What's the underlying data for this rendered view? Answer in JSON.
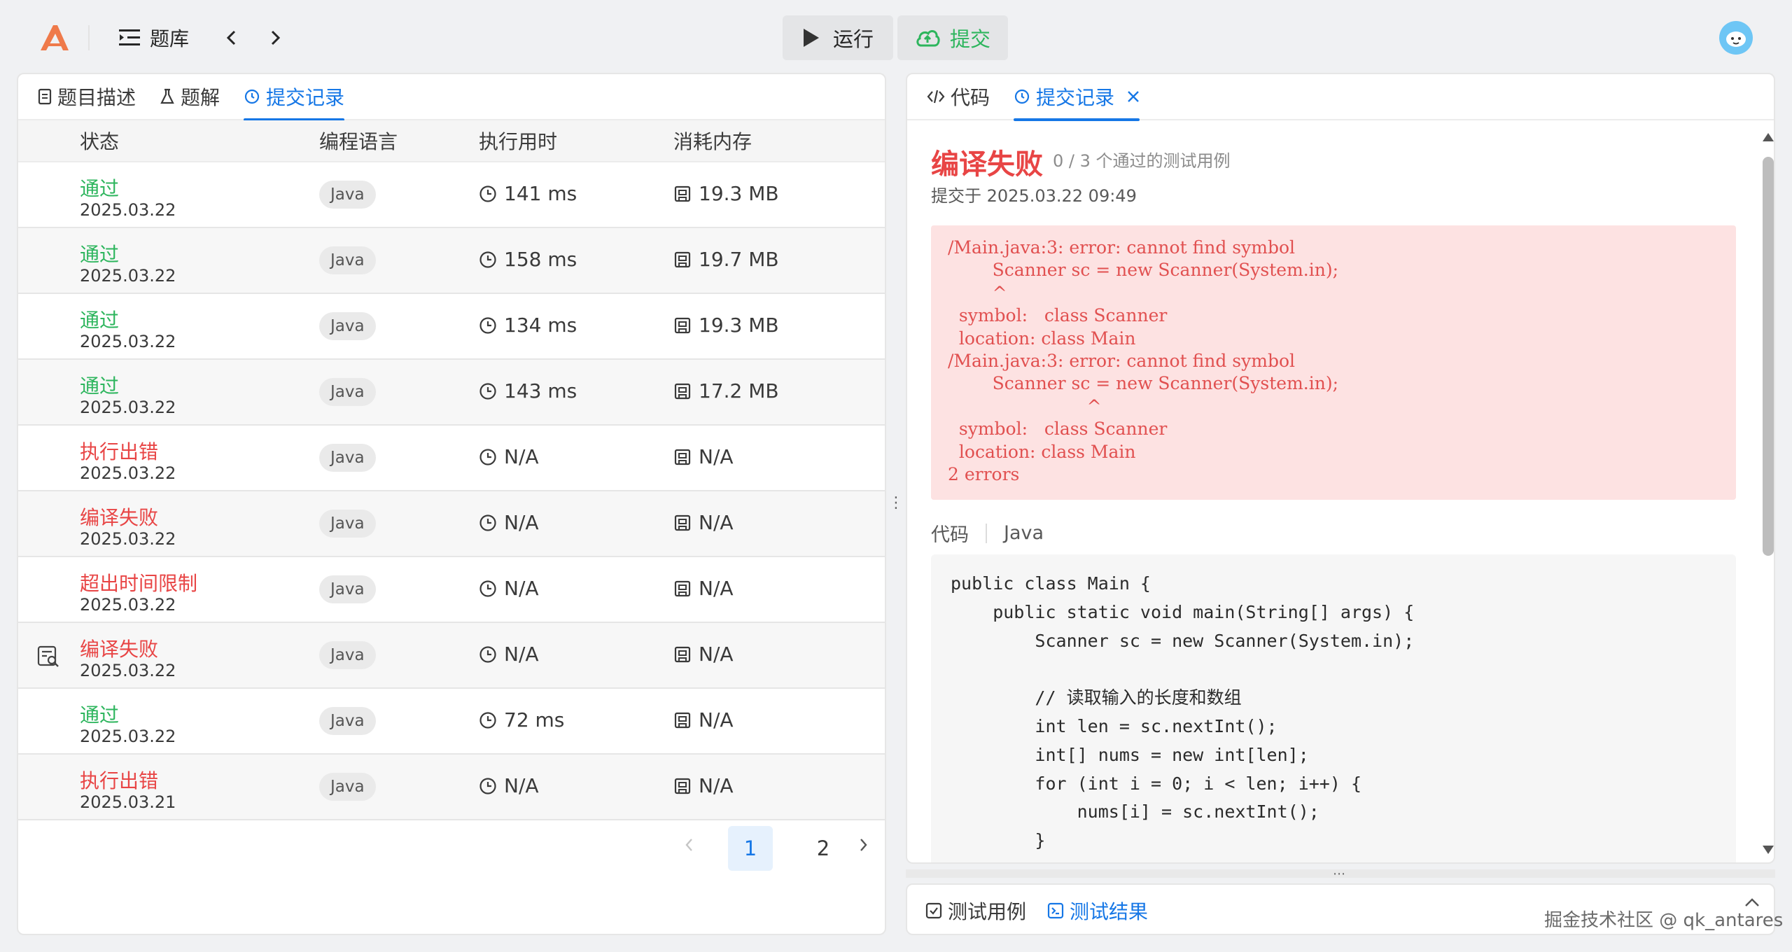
{
  "topbar": {
    "problem_bank_label": "题库",
    "run_label": "运行",
    "submit_label": "提交",
    "colors": {
      "submit": "#2db55d",
      "accent": "#1677e6"
    }
  },
  "left": {
    "tabs": [
      {
        "label": "题目描述",
        "icon": "document-icon"
      },
      {
        "label": "题解",
        "icon": "flask-icon"
      },
      {
        "label": "提交记录",
        "icon": "history-icon"
      }
    ],
    "headers": {
      "status": "状态",
      "lang": "编程语言",
      "time": "执行用时",
      "mem": "消耗内存"
    },
    "rows": [
      {
        "status": "通过",
        "date": "2025.03.22",
        "lang": "Java",
        "time": "141 ms",
        "mem": "19.3 MB"
      },
      {
        "status": "通过",
        "date": "2025.03.22",
        "lang": "Java",
        "time": "158 ms",
        "mem": "19.7 MB"
      },
      {
        "status": "通过",
        "date": "2025.03.22",
        "lang": "Java",
        "time": "134 ms",
        "mem": "19.3 MB"
      },
      {
        "status": "通过",
        "date": "2025.03.22",
        "lang": "Java",
        "time": "143 ms",
        "mem": "17.2 MB"
      },
      {
        "status": "执行出错",
        "date": "2025.03.22",
        "lang": "Java",
        "time": "N/A",
        "mem": "N/A"
      },
      {
        "status": "编译失败",
        "date": "2025.03.22",
        "lang": "Java",
        "time": "N/A",
        "mem": "N/A"
      },
      {
        "status": "超出时间限制",
        "date": "2025.03.22",
        "lang": "Java",
        "time": "N/A",
        "mem": "N/A"
      },
      {
        "status": "编译失败",
        "date": "2025.03.22",
        "lang": "Java",
        "time": "N/A",
        "mem": "N/A"
      },
      {
        "status": "通过",
        "date": "2025.03.22",
        "lang": "Java",
        "time": "72 ms",
        "mem": "N/A"
      },
      {
        "status": "执行出错",
        "date": "2025.03.21",
        "lang": "Java",
        "time": "N/A",
        "mem": "N/A"
      }
    ],
    "pagination": {
      "page1": "1",
      "page2": "2"
    }
  },
  "right": {
    "tabs": [
      {
        "label": "代码",
        "icon": "code-icon"
      },
      {
        "label": "提交记录",
        "icon": "history-icon"
      }
    ],
    "result_title": "编译失败",
    "result_cases": "0 / 3 个通过的测试用例",
    "submitted_at": "提交于 2025.03.22 09:49",
    "error_text": "/Main.java:3: error: cannot find symbol\n        Scanner sc = new Scanner(System.in);\n        ^\n  symbol:   class Scanner\n  location: class Main\n/Main.java:3: error: cannot find symbol\n        Scanner sc = new Scanner(System.in);\n                         ^\n  symbol:   class Scanner\n  location: class Main\n2 errors",
    "code_label": "代码",
    "code_lang": "Java",
    "code_text": "public class Main {\n    public static void main(String[] args) {\n        Scanner sc = new Scanner(System.in);\n\n        // 读取输入的长度和数组\n        int len = sc.nextInt();\n        int[] nums = new int[len];\n        for (int i = 0; i < len; i++) {\n            nums[i] = sc.nextInt();\n        }"
  },
  "bottom": {
    "tabs": [
      {
        "label": "测试用例",
        "icon": "checkbox-icon"
      },
      {
        "label": "测试结果",
        "icon": "terminal-icon"
      }
    ]
  },
  "watermark": "掘金技术社区 @ qk_antares"
}
